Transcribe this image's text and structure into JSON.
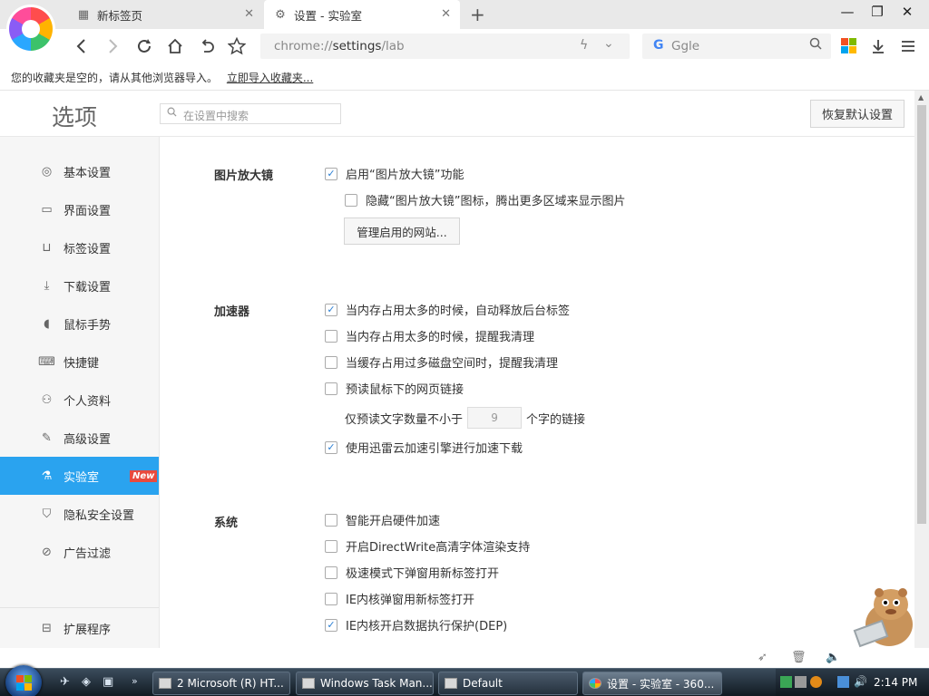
{
  "browser": {
    "tabs": [
      {
        "title": "新标签页",
        "active": false
      },
      {
        "title": "设置 - 实验室",
        "active": true
      }
    ],
    "new_tab_symbol": "+",
    "window_controls": {
      "minimize": "—",
      "restore": "❐",
      "close": "✕"
    },
    "address": {
      "prefix": "chrome://",
      "path": "settings",
      "suffix": "/lab"
    },
    "search": {
      "engine_letter": "G",
      "placeholder": "Ggle"
    },
    "bookmark_bar": {
      "message": "您的收藏夹是空的，请从其他浏览器导入。",
      "import_link": "立即导入收藏夹..."
    }
  },
  "settings": {
    "page_title": "选项",
    "search_placeholder": "在设置中搜索",
    "reset_label": "恢复默认设置",
    "sidebar": [
      {
        "label": "基本设置",
        "icon": "target-icon"
      },
      {
        "label": "界面设置",
        "icon": "window-icon"
      },
      {
        "label": "标签设置",
        "icon": "tab-icon"
      },
      {
        "label": "下载设置",
        "icon": "download-icon"
      },
      {
        "label": "鼠标手势",
        "icon": "mouse-icon"
      },
      {
        "label": "快捷键",
        "icon": "keyboard-icon"
      },
      {
        "label": "个人资料",
        "icon": "person-icon"
      },
      {
        "label": "高级设置",
        "icon": "wrench-icon"
      },
      {
        "label": "实验室",
        "icon": "flask-icon",
        "active": true,
        "badge": "New"
      },
      {
        "label": "隐私安全设置",
        "icon": "shield-icon"
      },
      {
        "label": "广告过滤",
        "icon": "block-icon"
      }
    ],
    "extensions_label": "扩展程序",
    "sections": {
      "magnifier": {
        "title": "图片放大镜",
        "options": [
          {
            "label": "启用“图片放大镜”功能",
            "checked": true
          },
          {
            "label": "隐藏“图片放大镜”图标，腾出更多区域来显示图片",
            "checked": false
          }
        ],
        "manage_button": "管理启用的网站..."
      },
      "accelerator": {
        "title": "加速器",
        "options": [
          {
            "label": "当内存占用太多的时候，自动释放后台标签",
            "checked": true
          },
          {
            "label": "当内存占用太多的时候，提醒我清理",
            "checked": false
          },
          {
            "label": "当缓存占用过多磁盘空间时，提醒我清理",
            "checked": false
          },
          {
            "label": "预读鼠标下的网页链接",
            "checked": false
          }
        ],
        "preread_prefix": "仅预读文字数量不小于",
        "preread_value": "9",
        "preread_suffix": "个字的链接",
        "xunlei": {
          "label": "使用迅雷云加速引擎进行加速下载",
          "checked": true
        }
      },
      "system": {
        "title": "系统",
        "options": [
          {
            "label": "智能开启硬件加速",
            "checked": false
          },
          {
            "label": "开启DirectWrite高清字体渲染支持",
            "checked": false
          },
          {
            "label": "极速模式下弹窗用新标签打开",
            "checked": false
          },
          {
            "label": "IE内核弹窗用新标签打开",
            "checked": false
          },
          {
            "label": "IE内核开启数据执行保护(DEP)",
            "checked": true
          }
        ]
      }
    }
  },
  "taskbar": {
    "items": [
      {
        "label": "2 Microsoft (R) HT...",
        "active": false
      },
      {
        "label": "Windows Task Man...",
        "active": false
      },
      {
        "label": "Default",
        "active": false
      },
      {
        "label": "设置 - 实验室 - 360...",
        "active": true
      }
    ],
    "clock": "2:14 PM"
  },
  "colors": {
    "accent": "#2aa3ef",
    "badge": "#e84a3e",
    "checkmark": "#2a7fd4"
  }
}
